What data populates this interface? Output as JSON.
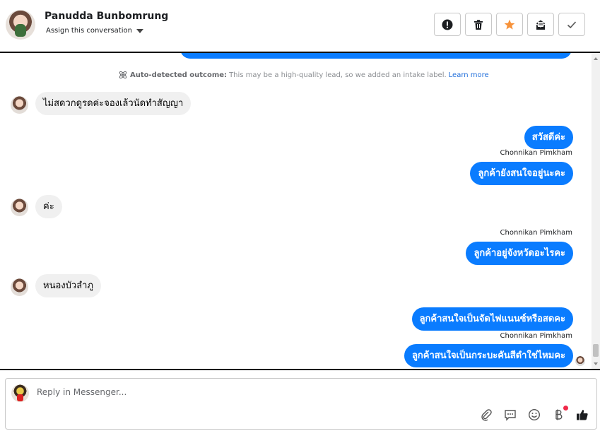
{
  "header": {
    "contact_name": "Panudda Bunbomrung",
    "assign_label": "Assign this conversation",
    "actions": [
      {
        "name": "mark-spam-button",
        "icon": "exclamation-icon"
      },
      {
        "name": "delete-button",
        "icon": "trash-icon"
      },
      {
        "name": "star-button",
        "icon": "star-icon",
        "color": "#f7923a"
      },
      {
        "name": "mark-unread-button",
        "icon": "envelope-icon"
      },
      {
        "name": "mark-done-button",
        "icon": "check-icon"
      }
    ]
  },
  "outcome": {
    "label": "Auto-detected outcome:",
    "text": "This may be a high-quality lead, so we added an intake label.",
    "link": "Learn more"
  },
  "messages": {
    "in1": "ไม่สดวกดูรดค่ะจองเล้วนัดทำสัญญา",
    "out1": "สวัสดีค่ะ",
    "sender1": "Chonnikan Pimkham",
    "out2": "ลูกค้ายังสนใจอยู่นะคะ",
    "in2": "ค่ะ",
    "sender2": "Chonnikan Pimkham",
    "out3": "ลูกค้าอยู่จังหวัดอะไรคะ",
    "in3": "หนองบัวลำภู",
    "out4": "ลูกค้าสนใจเป็นจัดไฟแนนซ์หรือสดคะ",
    "sender3": "Chonnikan Pimkham",
    "out5": "ลูกค้าสนใจเป็นกระบะคันสีดำใช่ไหมคะ"
  },
  "composer": {
    "placeholder": "Reply in Messenger...",
    "tools": [
      "paperclip-icon",
      "saved-replies-icon",
      "emoji-icon",
      "baht-payment-icon",
      "thumbs-up-icon"
    ]
  },
  "colors": {
    "accent": "#0a7cff",
    "incoming_bubble": "#f0f0f0",
    "star": "#f7923a",
    "notification_dot": "#f02849"
  }
}
